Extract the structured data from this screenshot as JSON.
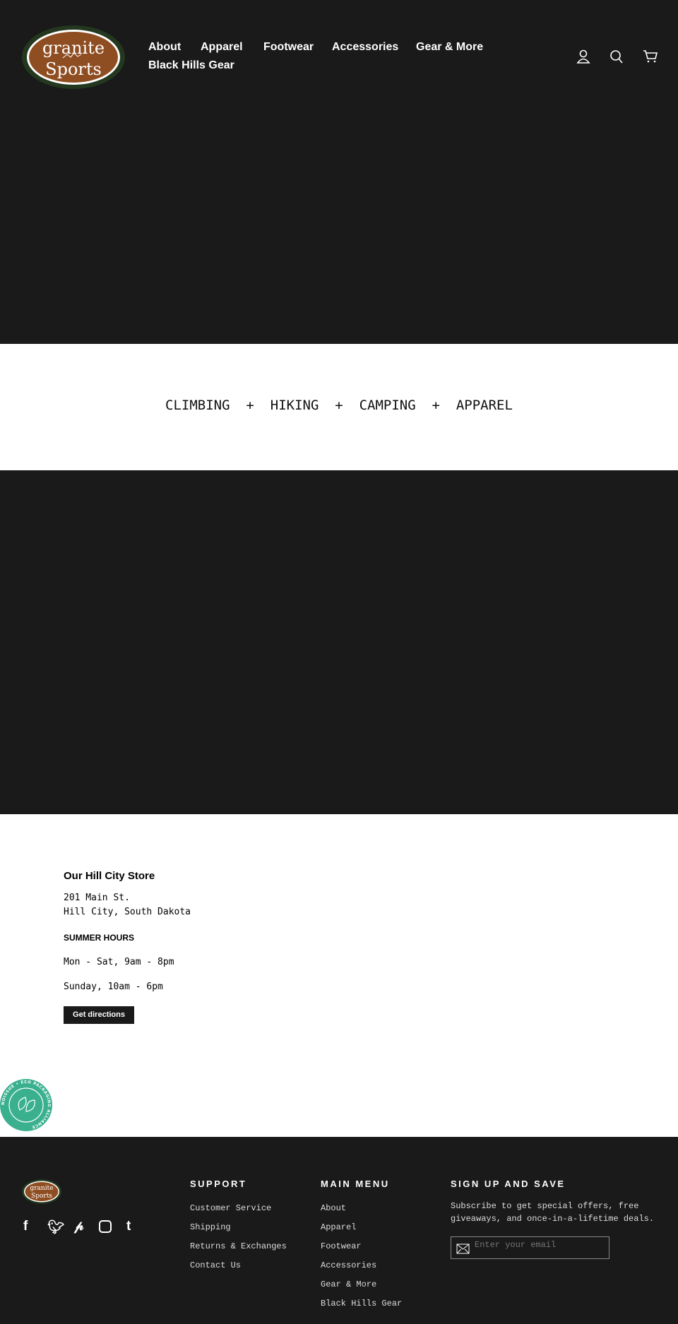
{
  "header": {
    "logo_text": "granite Sports",
    "nav": [
      "About",
      "Apparel",
      "Footwear",
      "Accessories",
      "Gear & More",
      "Black Hills Gear"
    ],
    "icons": [
      "account-icon",
      "search-icon",
      "cart-icon"
    ]
  },
  "tagline": "CLIMBING  +  HIKING  +  CAMPING  +  APPAREL",
  "store": {
    "title": "Our Hill City Store",
    "address1": "201 Main St.",
    "address2": "Hill City, South Dakota",
    "hours_title": "SUMMER HOURS",
    "hours1": "Mon - Sat, 9am - 8pm",
    "hours2": "Sunday, 10am - 6pm",
    "button": "Get directions"
  },
  "badge": {
    "text": "NOISSUE • ECO PACKAGING ALLIANCE",
    "color": "#3ab08f"
  },
  "footer": {
    "social": [
      "facebook-icon",
      "twitter-icon",
      "pinterest-icon",
      "instagram-icon",
      "tumblr-icon"
    ],
    "support": {
      "title": "SUPPORT",
      "links": [
        "Customer Service",
        "Shipping",
        "Returns & Exchanges",
        "Contact Us"
      ]
    },
    "menu": {
      "title": "MAIN MENU",
      "links": [
        "About",
        "Apparel",
        "Footwear",
        "Accessories",
        "Gear & More",
        "Black Hills Gear"
      ]
    },
    "signup": {
      "title": "SIGN UP AND SAVE",
      "text": "Subscribe to get special offers, free giveaways, and once-in-a-lifetime deals.",
      "placeholder": "Enter your email"
    }
  }
}
